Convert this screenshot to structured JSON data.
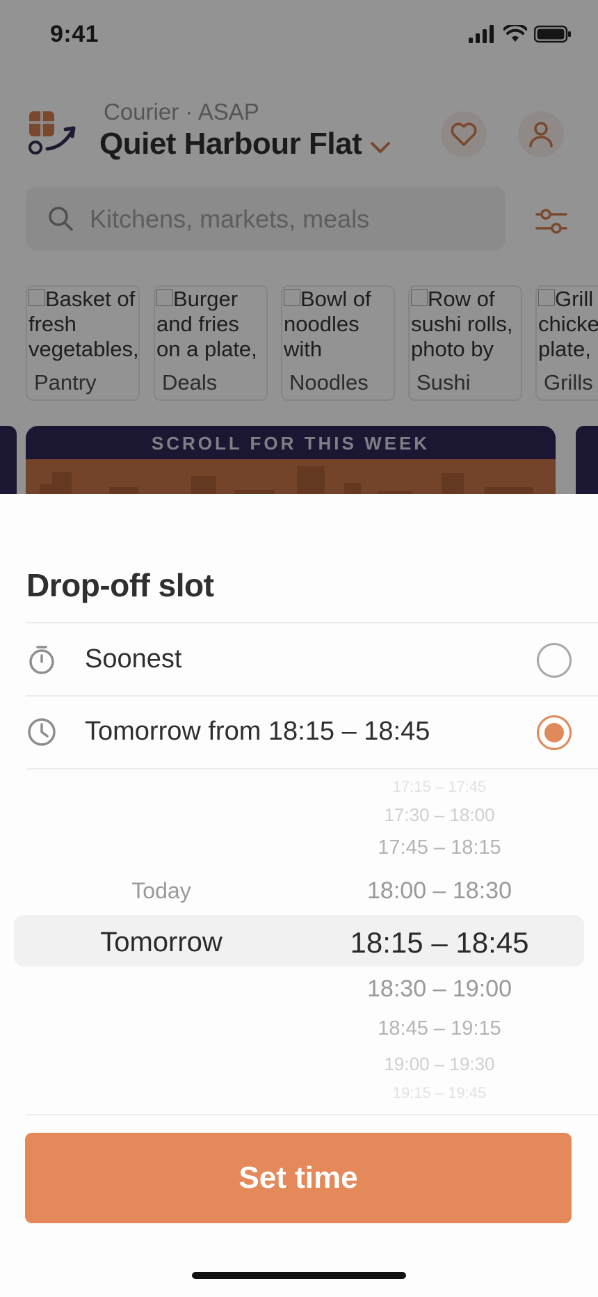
{
  "status_bar": {
    "time": "9:41"
  },
  "header": {
    "subtitle": "Courier · ASAP",
    "title": "Quiet Harbour Flat"
  },
  "search": {
    "placeholder": "Kitchens, markets, meals"
  },
  "categories": [
    {
      "alt": "Basket of fresh vegetables,",
      "label": "Pantry"
    },
    {
      "alt": "Burger and fries on a plate,",
      "label": "Deals"
    },
    {
      "alt": "Bowl of noodles with",
      "label": "Noodles"
    },
    {
      "alt": "Row of sushi rolls, photo by",
      "label": "Sushi"
    },
    {
      "alt": "Grill chicken plate,",
      "label": "Grills"
    }
  ],
  "promo": {
    "banner_text": "SCROLL FOR THIS WEEK"
  },
  "sheet": {
    "title": "Drop-off slot",
    "options": [
      {
        "label": "Soonest",
        "icon": "stopwatch-icon",
        "selected": false
      },
      {
        "label": "Tomorrow from 18:15 – 18:45",
        "icon": "clock-icon",
        "selected": true
      }
    ],
    "picker": {
      "days": [
        "Today",
        "Tomorrow"
      ],
      "selected_day": "Tomorrow",
      "slots": [
        "17:15 – 17:45",
        "17:30 – 18:00",
        "17:45 – 18:15",
        "18:00 – 18:30",
        "18:15 – 18:45",
        "18:30 – 19:00",
        "18:45 – 19:15",
        "19:00 – 19:30",
        "19:15 – 19:45"
      ],
      "selected_slot": "18:15 – 18:45"
    },
    "cta_label": "Set time"
  },
  "colors": {
    "accent": "#E4895A",
    "promo_band": "#1E1447",
    "scrim": "#191919"
  }
}
